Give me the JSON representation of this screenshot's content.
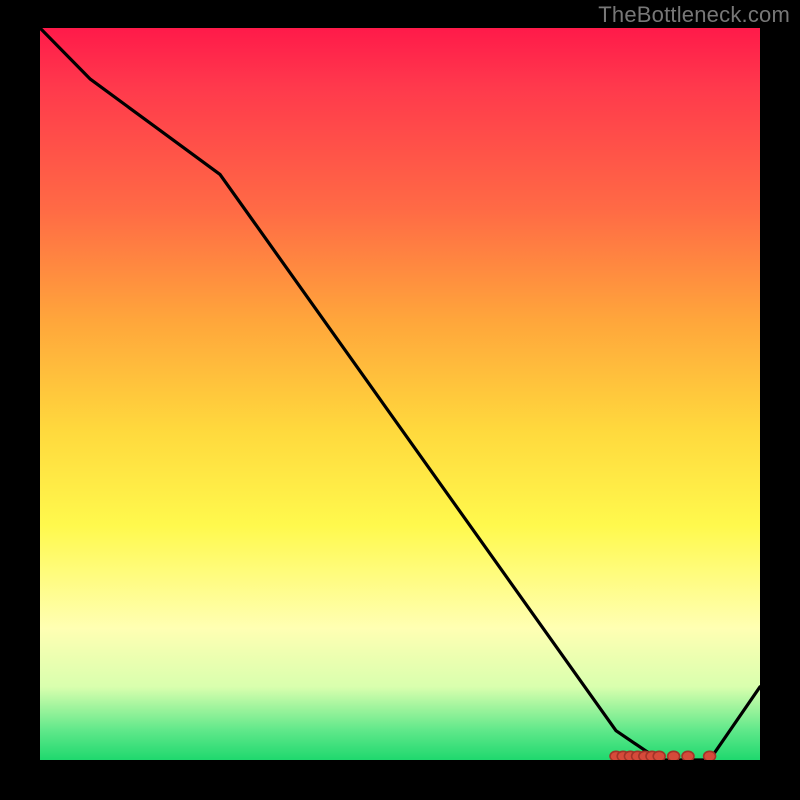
{
  "watermark": "TheBottleneck.com",
  "chart_data": {
    "type": "line",
    "title": "",
    "xlabel": "",
    "ylabel": "",
    "xlim": [
      0,
      100
    ],
    "ylim": [
      0,
      100
    ],
    "x": [
      0,
      7,
      25,
      80,
      86,
      88,
      93,
      100
    ],
    "values": [
      100,
      93,
      80,
      4,
      0,
      0,
      0,
      10
    ],
    "marker_points": [
      {
        "x": 80,
        "y": 0.5
      },
      {
        "x": 81,
        "y": 0.5
      },
      {
        "x": 82,
        "y": 0.5
      },
      {
        "x": 83,
        "y": 0.5
      },
      {
        "x": 84,
        "y": 0.5
      },
      {
        "x": 85,
        "y": 0.5
      },
      {
        "x": 86,
        "y": 0.5
      },
      {
        "x": 88,
        "y": 0.5
      },
      {
        "x": 90,
        "y": 0.5
      },
      {
        "x": 93,
        "y": 0.5
      }
    ],
    "background_gradient": {
      "top": "#ff1a4a",
      "middle": "#ffd93d",
      "bottom": "#1fd86e"
    }
  }
}
